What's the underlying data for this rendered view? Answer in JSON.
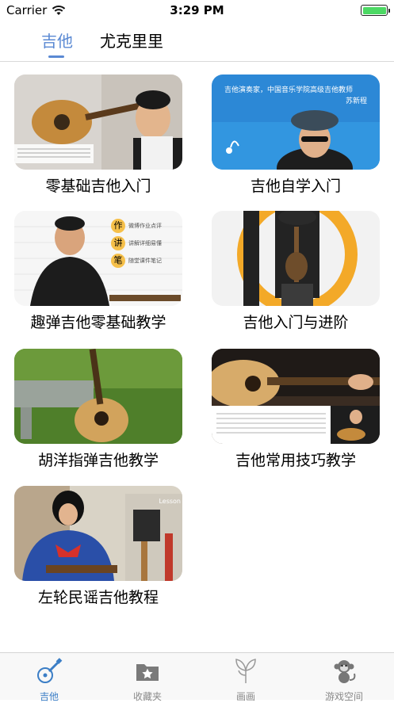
{
  "status": {
    "carrier": "Carrier",
    "time": "3:29 PM"
  },
  "top_tabs": [
    {
      "label": "吉他"
    },
    {
      "label": "尤克里里"
    }
  ],
  "courses": [
    {
      "title": "零基础吉他入门",
      "thumb_caption": ""
    },
    {
      "title": "吉他自学入门",
      "thumb_caption": "吉他演奏家，中国音乐学院高级吉他教师",
      "thumb_caption2": "苏新程"
    },
    {
      "title": "趣弹吉他零基础教学",
      "badges": [
        {
          "char": "作",
          "text": "微博作业点评"
        },
        {
          "char": "讲",
          "text": "讲解详细易懂"
        },
        {
          "char": "笔",
          "text": "随堂课件笔记"
        }
      ]
    },
    {
      "title": "吉他入门与进阶"
    },
    {
      "title": "胡洋指弹吉他教学"
    },
    {
      "title": "吉他常用技巧教学"
    },
    {
      "title": "左轮民谣吉他教程",
      "thumb_caption": "Lesson"
    }
  ],
  "bottom_tabs": [
    {
      "label": "吉他",
      "icon": "guitar-icon"
    },
    {
      "label": "收藏夹",
      "icon": "star-folder-icon"
    },
    {
      "label": "画画",
      "icon": "palette-icon"
    },
    {
      "label": "游戏空间",
      "icon": "monkey-icon"
    }
  ],
  "colors": {
    "accent": "#5a89d3",
    "battery": "#4cd964"
  }
}
